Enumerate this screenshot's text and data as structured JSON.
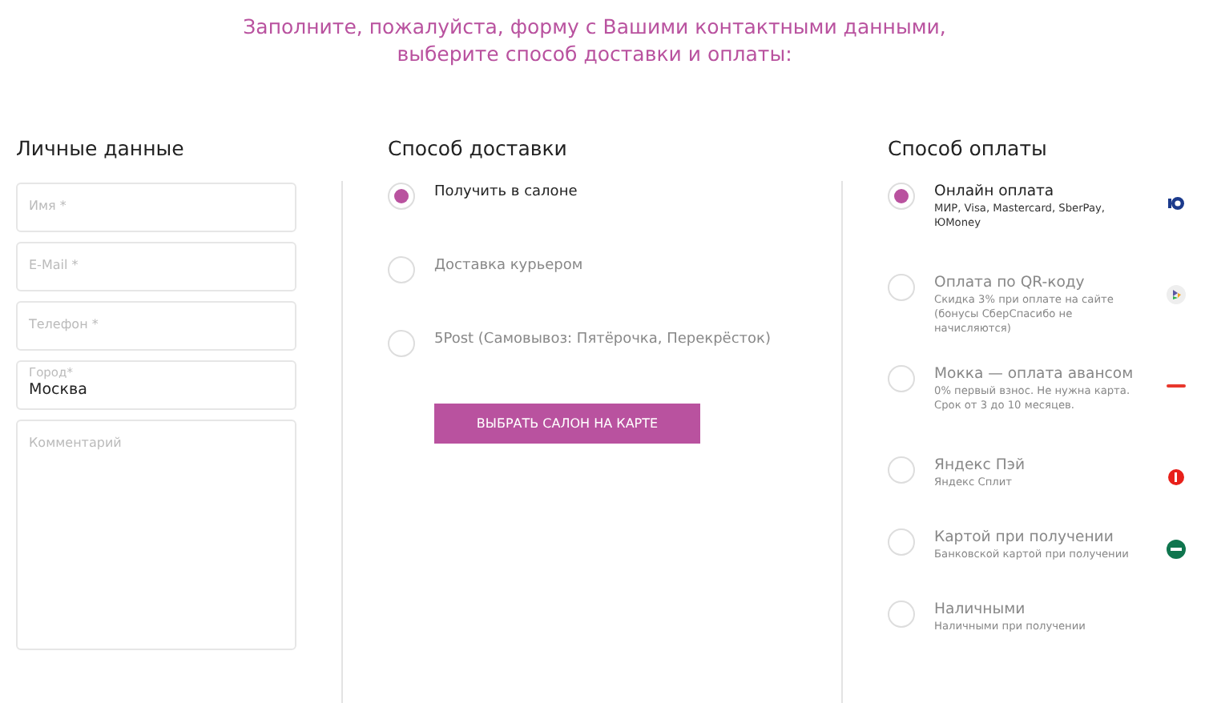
{
  "intro": "Заполните, пожалуйста, форму с Вашими контактными данными, выберите способ доставки и оплаты:",
  "personal": {
    "title": "Личные данные",
    "fields": [
      {
        "kind": "input",
        "placeholder": "Имя *"
      },
      {
        "kind": "input",
        "placeholder": "E-Mail *"
      },
      {
        "kind": "input",
        "placeholder": "Телефон *"
      },
      {
        "kind": "labeled",
        "label": "Город*",
        "value": "Москва"
      },
      {
        "kind": "textarea",
        "placeholder": "Комментарий"
      }
    ]
  },
  "delivery": {
    "title": "Способ доставки",
    "options": [
      {
        "label": "Получить в салоне",
        "selected": true
      },
      {
        "label": "Доставка курьером",
        "selected": false
      },
      {
        "label": "5Post (Самовывоз: Пятёрочка, Перекрёсток)",
        "selected": false
      }
    ],
    "button": "ВЫБРАТЬ САЛОН НА КАРТЕ"
  },
  "payment": {
    "title": "Способ оплаты",
    "options": [
      {
        "label": "Онлайн оплата",
        "note": "МИР, Visa, Mastercard, SberPay, ЮMoney",
        "selected": true,
        "kind": "yoomoney"
      },
      {
        "label": "Оплата по QR-коду",
        "note": "Скидка 3% при оплате на сайте (бонусы СберСпасибо не начисляются)",
        "selected": false,
        "kind": "sbp"
      },
      {
        "label": "Мокка — оплата авансом",
        "note": "0% первый взнос. Не нужна карта. Срок от 3 до 10 месяцев.",
        "selected": false,
        "kind": "mokka"
      },
      {
        "label": "Яндекс Пэй",
        "note": "Яндекс Сплит",
        "selected": false,
        "kind": "yandex"
      },
      {
        "label": "Картой при получении",
        "note": "Банковской картой при получении",
        "selected": false,
        "kind": "card"
      },
      {
        "label": "Наличными",
        "note": "Наличными при получении",
        "selected": false,
        "kind": "cash"
      }
    ]
  }
}
